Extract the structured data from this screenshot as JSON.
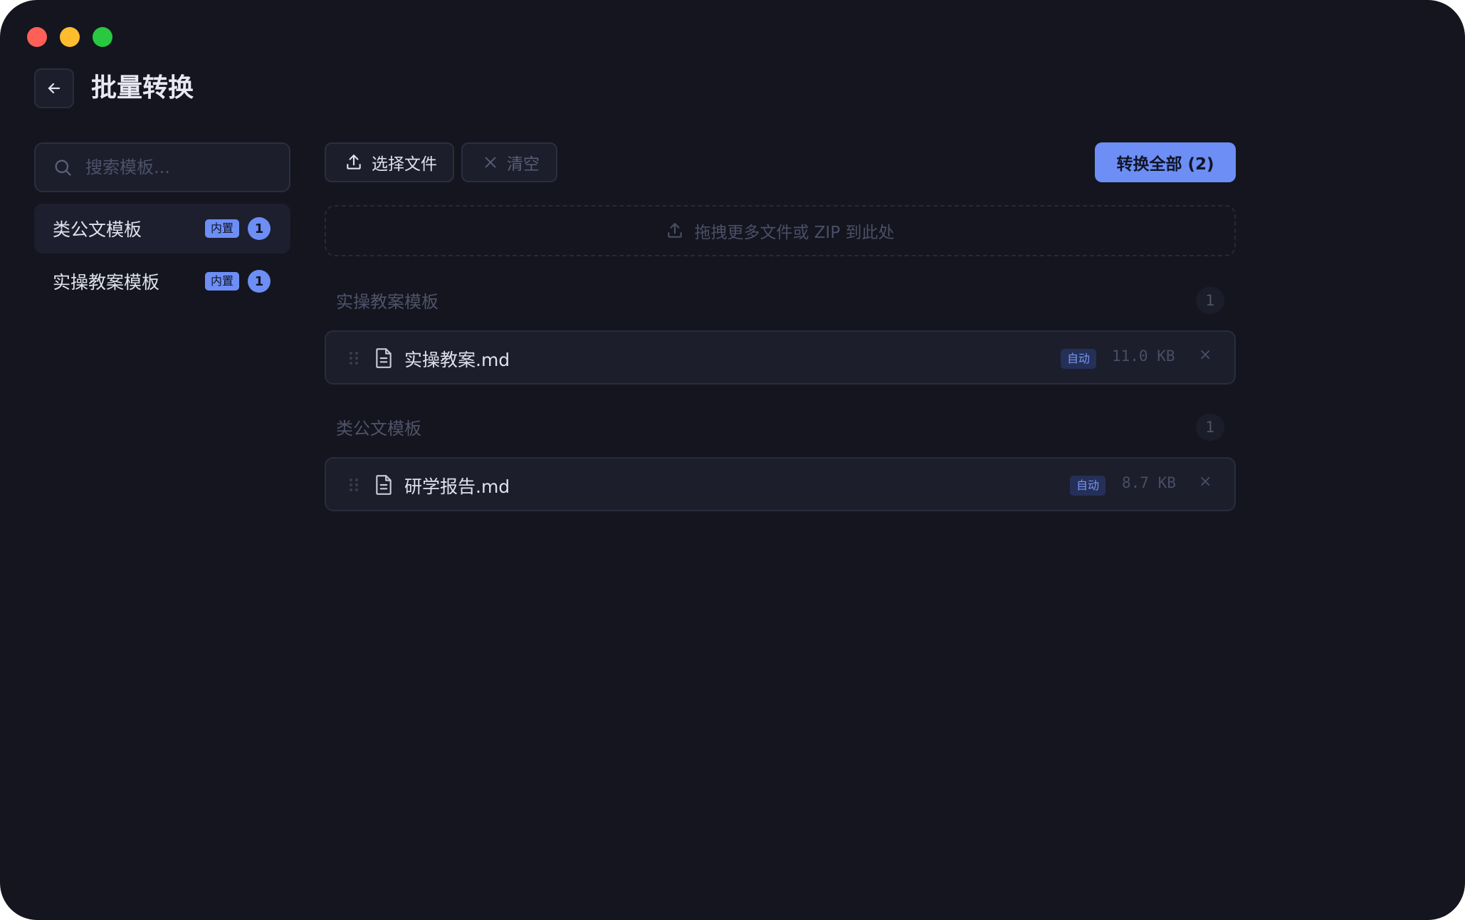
{
  "header": {
    "title": "批量转换"
  },
  "sidebar": {
    "search_placeholder": "搜索模板...",
    "items": [
      {
        "label": "类公文模板",
        "badge": "内置",
        "count": "1",
        "active": true
      },
      {
        "label": "实操教案模板",
        "badge": "内置",
        "count": "1",
        "active": false
      }
    ]
  },
  "toolbar": {
    "select_label": "选择文件",
    "clear_label": "清空",
    "convert_label": "转换全部 (2)"
  },
  "dropzone": {
    "label": "拖拽更多文件或 ZIP 到此处"
  },
  "groups": [
    {
      "title": "实操教案模板",
      "count": "1",
      "files": [
        {
          "name": "实操教案.md",
          "tag": "自动",
          "size": "11.0 KB",
          "remove": "×"
        }
      ]
    },
    {
      "title": "类公文模板",
      "count": "1",
      "files": [
        {
          "name": "研学报告.md",
          "tag": "自动",
          "size": "8.7 KB",
          "remove": "×"
        }
      ]
    }
  ],
  "colors": {
    "background": "#14151f",
    "panel": "#1c1e2c",
    "accent": "#6c8ef5",
    "text_primary": "#dfe1ec",
    "text_muted": "#4f5369"
  },
  "icons": {
    "back": "arrow-left-icon",
    "search": "search-icon",
    "upload": "upload-icon",
    "clear": "close-icon",
    "drag": "drag-handle-icon",
    "file": "document-icon"
  }
}
